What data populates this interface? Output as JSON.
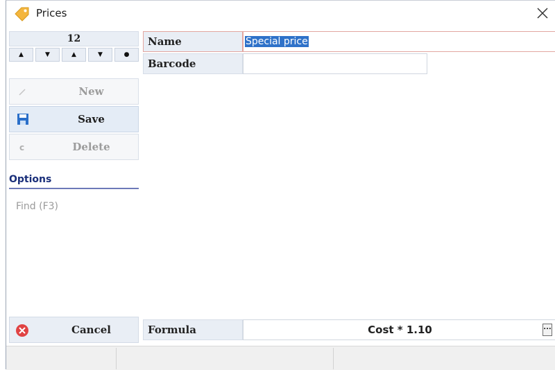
{
  "window": {
    "title": "Prices",
    "title_icon": "price-tag-icon",
    "close_icon": "close-icon"
  },
  "navigator": {
    "record": "12",
    "buttons": [
      "first",
      "previous",
      "next",
      "last",
      "current"
    ]
  },
  "actions": {
    "new_label": "New",
    "save_label": "Save",
    "delete_label": "Delete",
    "cancel_label": "Cancel"
  },
  "options": {
    "header": "Options",
    "find_label": "Find  (F3)"
  },
  "form": {
    "name_label": "Name",
    "name_value": "Special price",
    "barcode_label": "Barcode",
    "barcode_value": "",
    "formula_label": "Formula",
    "formula_value": "Cost * 1.10",
    "formula_button": "..."
  },
  "colors": {
    "accent": "#2f72c9",
    "options_header": "#1a2f7a",
    "cancel_icon": "#e04343",
    "label_bg": "#e9eef5"
  }
}
